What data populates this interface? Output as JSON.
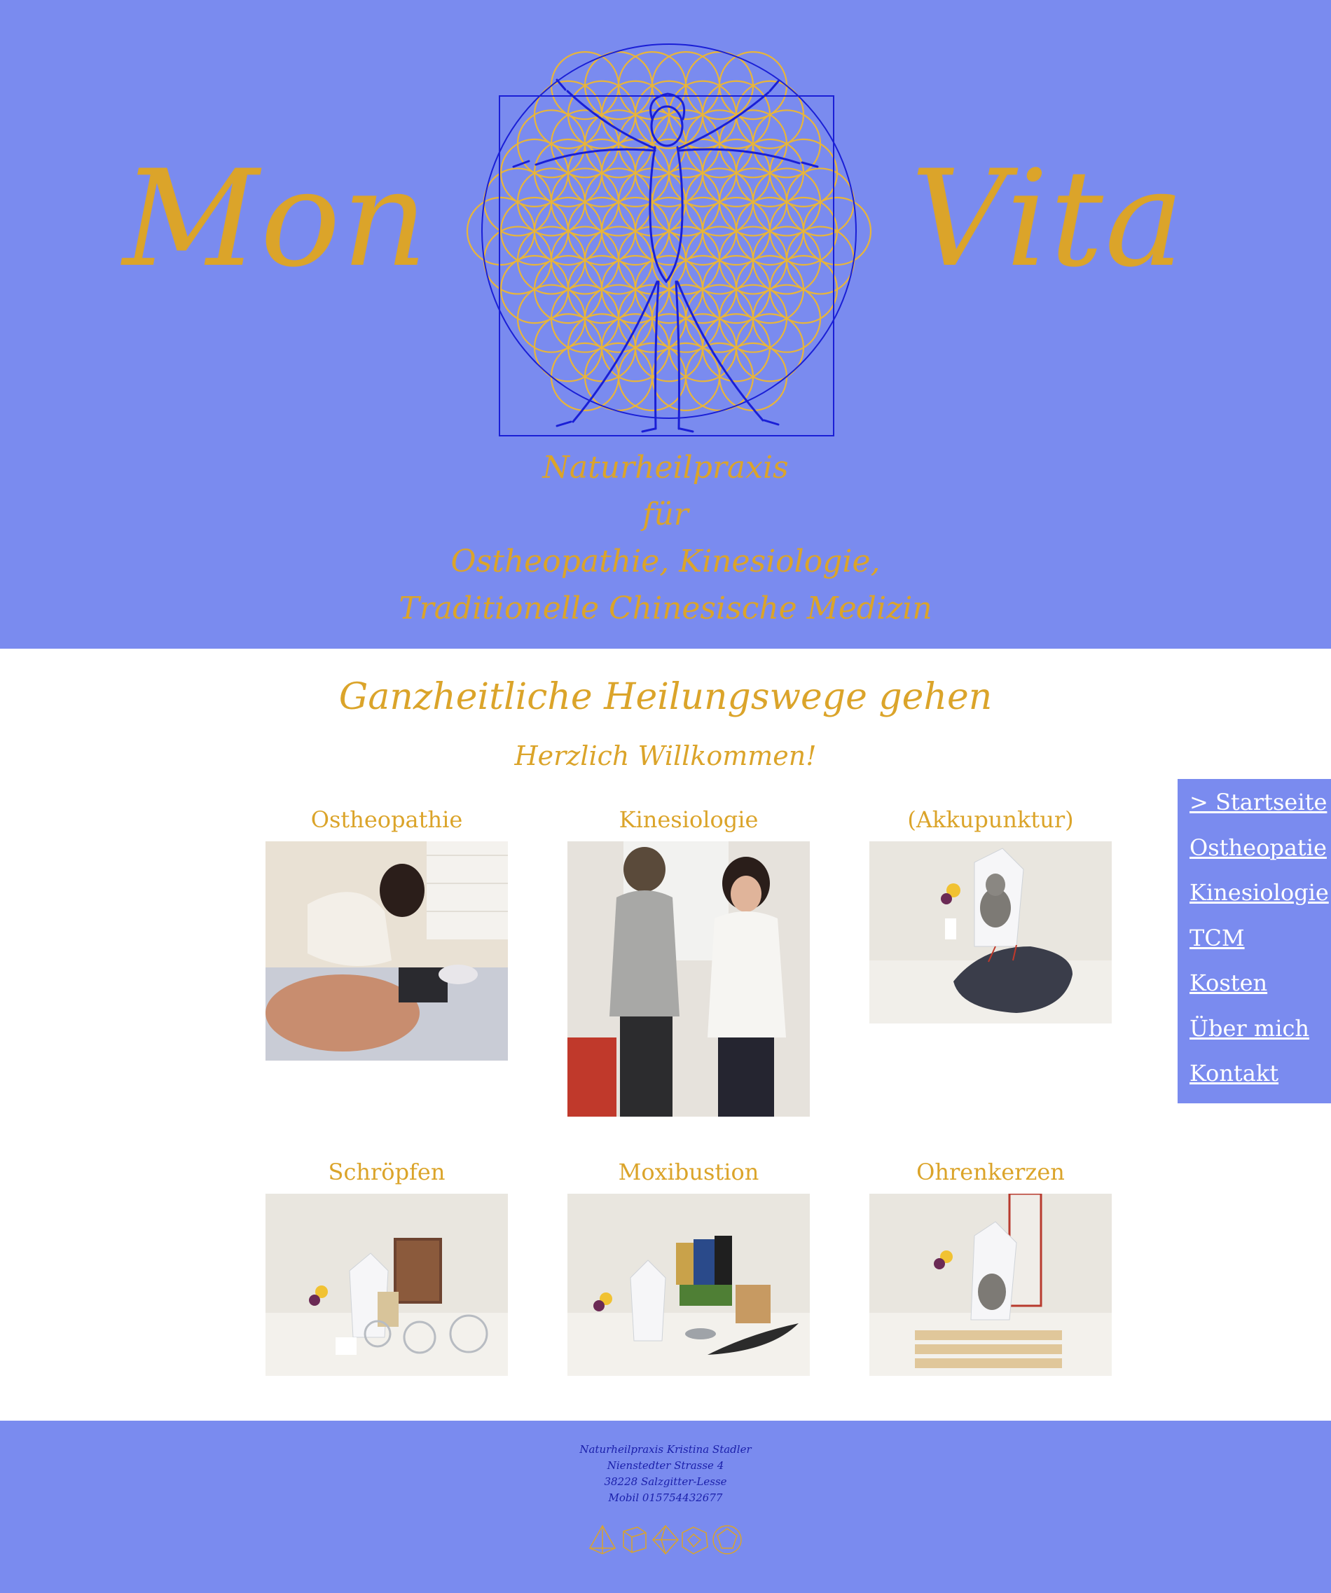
{
  "header": {
    "brand_left": "Mon",
    "brand_right": "Vita",
    "tagline": [
      "Naturheilpraxis",
      "für",
      "Ostheopathie, Kinesiologie,",
      "Traditionelle Chinesische Medizin"
    ]
  },
  "main": {
    "title": "Ganzheitliche Heilungswege gehen",
    "welcome": "Herzlich Willkommen!",
    "tiles": [
      {
        "caption": "Ostheopathie"
      },
      {
        "caption": "Kinesiologie"
      },
      {
        "caption": "(Akkupunktur)"
      },
      {
        "caption": "Schröpfen"
      },
      {
        "caption": "Moxibustion"
      },
      {
        "caption": "Ohrenkerzen"
      }
    ]
  },
  "nav": {
    "items": [
      {
        "label": "> Startseite"
      },
      {
        "label": "Ostheopatie"
      },
      {
        "label": "Kinesiologie"
      },
      {
        "label": "TCM"
      },
      {
        "label": "Kosten"
      },
      {
        "label": "Über mich"
      },
      {
        "label": "Kontakt"
      }
    ]
  },
  "footer": {
    "address": [
      "Naturheilpraxis Kristina Stadler",
      "Nienstedter Strasse 4",
      "38228 Salzgitter-Lesse",
      "Mobil 015754432677"
    ]
  },
  "colors": {
    "header_bg": "#7a8bef",
    "accent_gold": "#dba42a",
    "line_blue": "#1a1fd6",
    "footer_text": "#1a1faa"
  },
  "icons": [
    "vitruvian-flower-of-life-logo",
    "platonic-solid-icons"
  ]
}
